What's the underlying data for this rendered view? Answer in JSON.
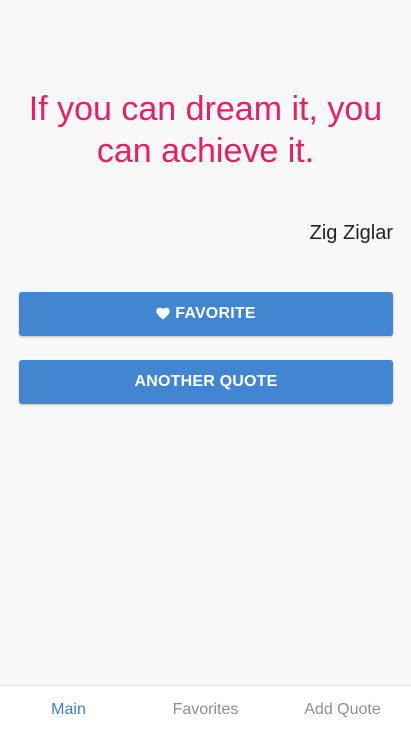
{
  "quote": {
    "text": "If you can dream it, you can achieve it.",
    "author": "Zig Ziglar"
  },
  "buttons": {
    "favorite_label": "FAVORITE",
    "favorite_icon": "heart-icon",
    "another_label": "ANOTHER QUOTE"
  },
  "tabs": [
    {
      "label": "Main",
      "active": true
    },
    {
      "label": "Favorites",
      "active": false
    },
    {
      "label": "Add Quote",
      "active": false
    }
  ],
  "colors": {
    "quote": "#e91e63",
    "button": "#4285d1",
    "active_tab": "#3b7fd4",
    "inactive_tab": "#8e8e93"
  }
}
